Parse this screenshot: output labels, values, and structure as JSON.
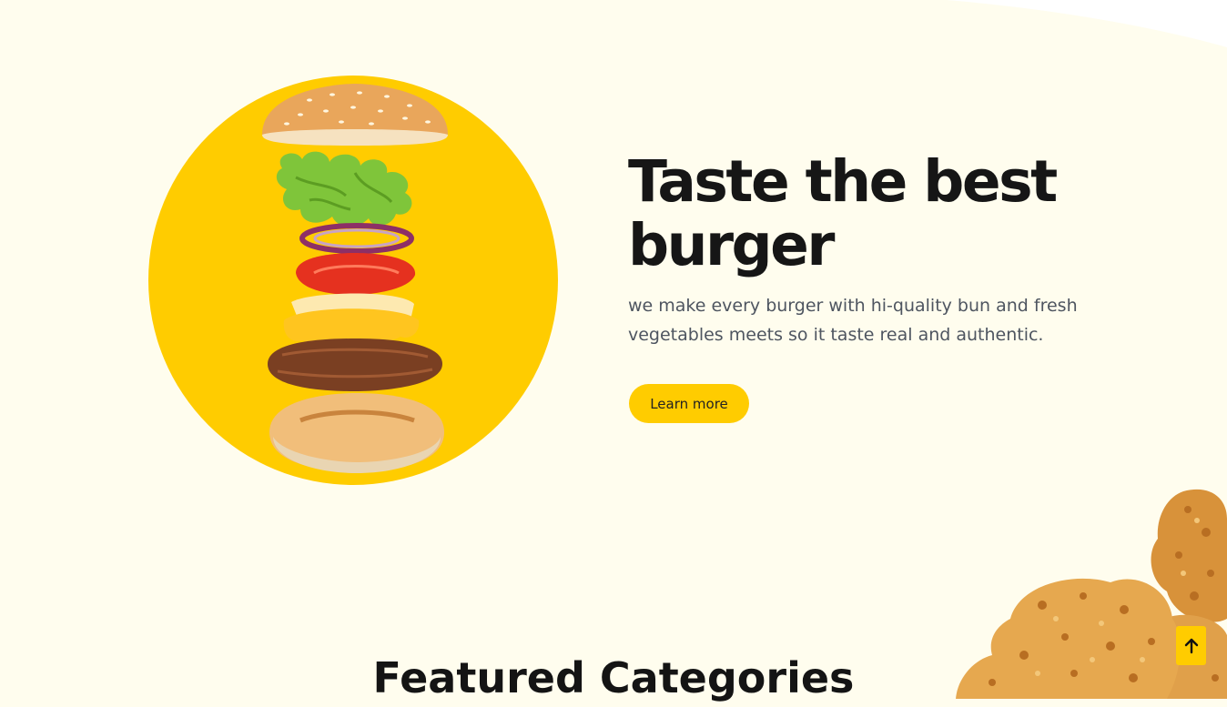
{
  "hero": {
    "title": "Taste the best burger",
    "description": "we make every burger with hi-quality bun and fresh vegetables meets so it taste real and authentic.",
    "cta_label": "Learn more",
    "image": "stacked-burger"
  },
  "featured": {
    "title": "Featured Categories"
  },
  "decor": {
    "side_image": "fried-chicken"
  },
  "scroll_top": {
    "icon": "arrow-up-icon"
  },
  "colors": {
    "background": "#fffdee",
    "accent": "#ffcc00",
    "heading": "#161616",
    "body_text": "#4e5560"
  }
}
